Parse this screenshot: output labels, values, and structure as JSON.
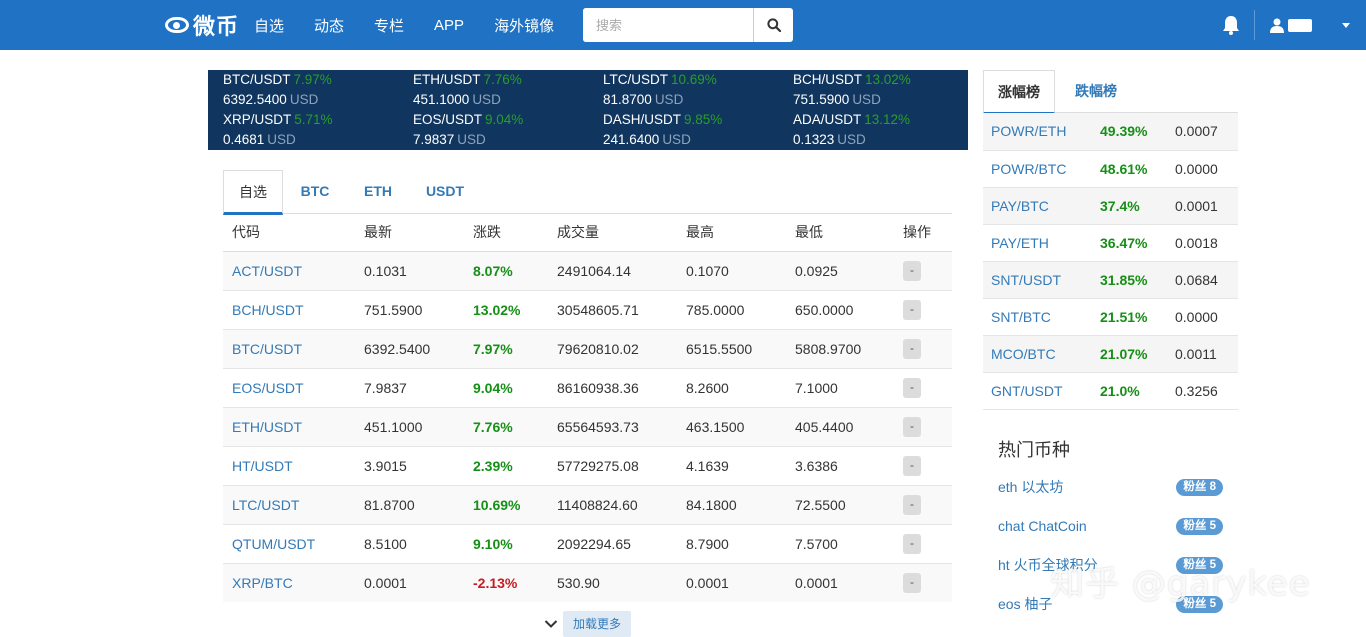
{
  "brand": {
    "name": "微币"
  },
  "nav": {
    "items": [
      "自选",
      "动态",
      "专栏",
      "APP",
      "海外镜像"
    ]
  },
  "search": {
    "placeholder": "搜索"
  },
  "ticker": [
    {
      "pair": "BTC/USDT",
      "change": "7.97%",
      "price": "6392.5400",
      "unit": "USD"
    },
    {
      "pair": "ETH/USDT",
      "change": "7.76%",
      "price": "451.1000",
      "unit": "USD"
    },
    {
      "pair": "LTC/USDT",
      "change": "10.69%",
      "price": "81.8700",
      "unit": "USD"
    },
    {
      "pair": "BCH/USDT",
      "change": "13.02%",
      "price": "751.5900",
      "unit": "USD"
    },
    {
      "pair": "XRP/USDT",
      "change": "5.71%",
      "price": "0.4681",
      "unit": "USD"
    },
    {
      "pair": "EOS/USDT",
      "change": "9.04%",
      "price": "7.9837",
      "unit": "USD"
    },
    {
      "pair": "DASH/USDT",
      "change": "9.85%",
      "price": "241.6400",
      "unit": "USD"
    },
    {
      "pair": "ADA/USDT",
      "change": "13.12%",
      "price": "0.1323",
      "unit": "USD"
    }
  ],
  "market": {
    "tabs": [
      "自选",
      "BTC",
      "ETH",
      "USDT"
    ],
    "active_tab": "自选",
    "columns": [
      "代码",
      "最新",
      "涨跌",
      "成交量",
      "最高",
      "最低",
      "操作"
    ],
    "rows": [
      {
        "code": "ACT/USDT",
        "last": "0.1031",
        "change": "8.07%",
        "volume": "2491064.14",
        "high": "0.1070",
        "low": "0.0925",
        "op": "-"
      },
      {
        "code": "BCH/USDT",
        "last": "751.5900",
        "change": "13.02%",
        "volume": "30548605.71",
        "high": "785.0000",
        "low": "650.0000",
        "op": "-"
      },
      {
        "code": "BTC/USDT",
        "last": "6392.5400",
        "change": "7.97%",
        "volume": "79620810.02",
        "high": "6515.5500",
        "low": "5808.9700",
        "op": "-"
      },
      {
        "code": "EOS/USDT",
        "last": "7.9837",
        "change": "9.04%",
        "volume": "86160938.36",
        "high": "8.2600",
        "low": "7.1000",
        "op": "-"
      },
      {
        "code": "ETH/USDT",
        "last": "451.1000",
        "change": "7.76%",
        "volume": "65564593.73",
        "high": "463.1500",
        "low": "405.4400",
        "op": "-"
      },
      {
        "code": "HT/USDT",
        "last": "3.9015",
        "change": "2.39%",
        "volume": "57729275.08",
        "high": "4.1639",
        "low": "3.6386",
        "op": "-"
      },
      {
        "code": "LTC/USDT",
        "last": "81.8700",
        "change": "10.69%",
        "volume": "11408824.60",
        "high": "84.1800",
        "low": "72.5500",
        "op": "-"
      },
      {
        "code": "QTUM/USDT",
        "last": "8.5100",
        "change": "9.10%",
        "volume": "2092294.65",
        "high": "8.7900",
        "low": "7.5700",
        "op": "-"
      },
      {
        "code": "XRP/BTC",
        "last": "0.0001",
        "change": "-2.13%",
        "volume": "530.90",
        "high": "0.0001",
        "low": "0.0001",
        "op": "-"
      }
    ],
    "load_more": "加载更多"
  },
  "rank": {
    "tabs": [
      "涨幅榜",
      "跌幅榜"
    ],
    "active_tab": "涨幅榜",
    "rows": [
      {
        "pair": "POWR/ETH",
        "change": "49.39%",
        "price": "0.0007"
      },
      {
        "pair": "POWR/BTC",
        "change": "48.61%",
        "price": "0.0000"
      },
      {
        "pair": "PAY/BTC",
        "change": "37.4%",
        "price": "0.0001"
      },
      {
        "pair": "PAY/ETH",
        "change": "36.47%",
        "price": "0.0018"
      },
      {
        "pair": "SNT/USDT",
        "change": "31.85%",
        "price": "0.0684"
      },
      {
        "pair": "SNT/BTC",
        "change": "21.51%",
        "price": "0.0000"
      },
      {
        "pair": "MCO/BTC",
        "change": "21.07%",
        "price": "0.0011"
      },
      {
        "pair": "GNT/USDT",
        "change": "21.0%",
        "price": "0.3256"
      }
    ]
  },
  "hot": {
    "title": "热门币种",
    "items": [
      {
        "name": "eth 以太坊",
        "fans": "粉丝 8"
      },
      {
        "name": "chat ChatCoin",
        "fans": "粉丝 5"
      },
      {
        "name": "ht 火币全球积分",
        "fans": "粉丝 5"
      },
      {
        "name": "eos 柚子",
        "fans": "粉丝 5"
      }
    ]
  },
  "watermark": "知乎 @garykee",
  "colors": {
    "navbar": "#1f72c4",
    "ticker_bg": "#10365f",
    "up": "#168f16",
    "down": "#c71c22",
    "link": "#337ab7"
  }
}
